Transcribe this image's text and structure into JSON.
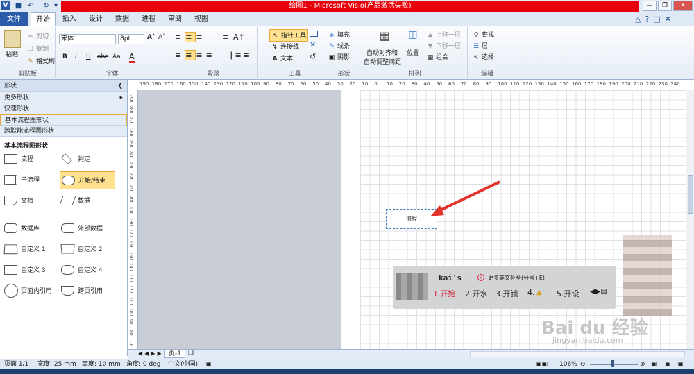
{
  "app": {
    "title": "绘图1 - Microsoft Visio(产品激活失败)"
  },
  "tabs": [
    "文件",
    "开始",
    "插入",
    "设计",
    "数据",
    "进程",
    "审阅",
    "视图"
  ],
  "ribbon": {
    "clipboard": {
      "label": "剪贴板",
      "paste": "粘贴",
      "cut": "剪切",
      "copy": "复制",
      "format_painter": "格式刷"
    },
    "font": {
      "label": "字体",
      "font_name": "宋体",
      "font_size": "8pt",
      "bold": "B",
      "italic": "I",
      "underline": "U",
      "strike": "abc",
      "aa": "Aa",
      "fontcolor": "A"
    },
    "paragraph": {
      "label": "段落"
    },
    "tools": {
      "label": "工具",
      "pointer": "指针工具",
      "connector": "连接线",
      "text": "文本"
    },
    "shape": {
      "label": "形状",
      "fill": "填充",
      "line": "线条",
      "shadow": "阴影"
    },
    "arrange": {
      "label": "排列",
      "align": "自动对齐和",
      "align2": "自动调整间距",
      "position": "位置",
      "bring_forward": "上移一层",
      "send_backward": "下移一层",
      "group": "组合"
    },
    "edit": {
      "label": "编辑",
      "find": "查找",
      "layers": "层",
      "select": "选择"
    }
  },
  "shapes_panel": {
    "title": "形状",
    "more": "更多形状",
    "quick": "快速形状",
    "basic": "基本流程图形状",
    "cross": "跨职能流程图形状",
    "section": "基本流程图形状",
    "items": [
      "流程",
      "判定",
      "子流程",
      "开始/结束",
      "文档",
      "数据",
      "数据库",
      "外部数据",
      "自定义 1",
      "自定义 2",
      "自定义 3",
      "自定义 4",
      "页面内引用",
      "跨页引用"
    ]
  },
  "ruler": {
    "top_labels": [
      "190",
      "180",
      "170",
      "160",
      "150",
      "140",
      "130",
      "120",
      "110",
      "100",
      "90",
      "80",
      "70",
      "60",
      "50",
      "40",
      "30",
      "20",
      "10",
      "0",
      "10",
      "20",
      "30",
      "40",
      "50",
      "60",
      "70",
      "80",
      "90",
      "100",
      "110",
      "120",
      "130",
      "140",
      "150",
      "160",
      "170",
      "180",
      "190",
      "200",
      "210",
      "220",
      "230",
      "240"
    ],
    "left_labels": [
      "290",
      "280",
      "270",
      "260",
      "250",
      "240",
      "230",
      "220",
      "210",
      "200",
      "190",
      "180",
      "170",
      "160",
      "150",
      "140",
      "130",
      "120",
      "110",
      "100",
      "90",
      "80",
      "70"
    ]
  },
  "canvas": {
    "shape_text": "流程"
  },
  "ime": {
    "input": "kai's",
    "hint": "更多英文补全(分号+E)",
    "candidates": [
      "1.开始",
      "2.开水",
      "3.开锁",
      "4.",
      "5.开设"
    ]
  },
  "page_tab": "页-1",
  "status": {
    "page": "页面 1/1",
    "width": "宽度: 25 mm",
    "height": "高度: 10 mm",
    "angle": "角度: 0 deg",
    "lang": "中文(中国)",
    "zoom": "106%"
  },
  "watermark": {
    "brand": "Bai du 经验",
    "url": "jingyan.baidu.com"
  },
  "colors": {
    "title_red": "#e8000b",
    "accent": "#2a5caa",
    "arrow": "#e0332a",
    "highlight": "#ffe18f"
  }
}
